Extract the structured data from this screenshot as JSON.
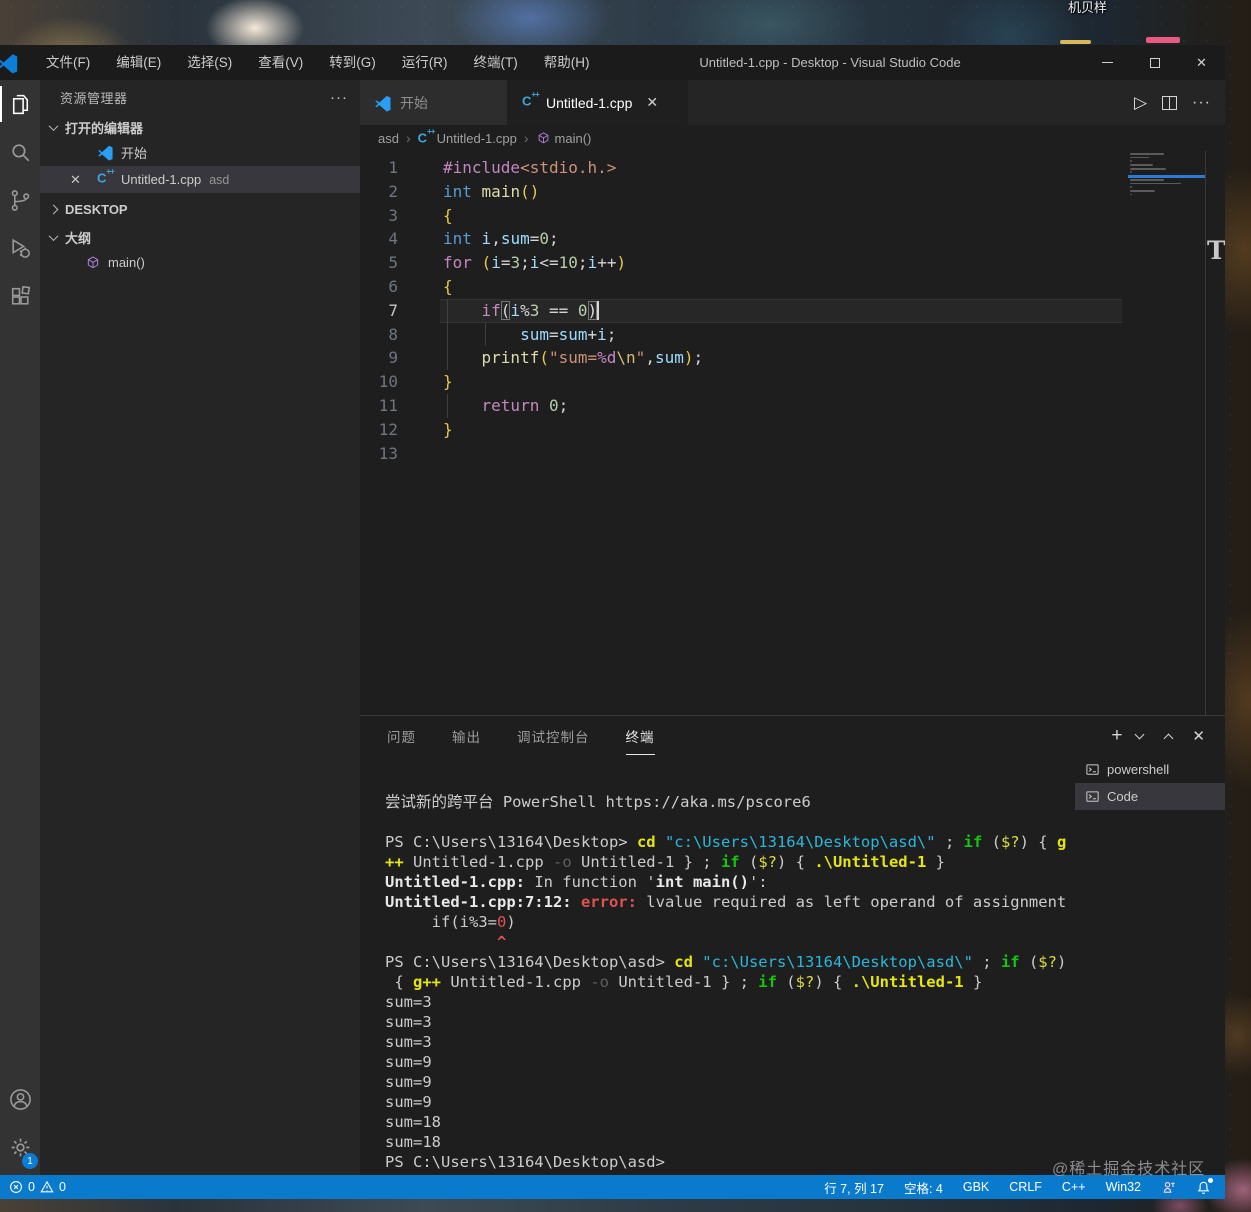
{
  "desktop": {
    "top_label": "机贝样",
    "watermark": "@稀土掘金技术社区",
    "stray_letter": "T"
  },
  "title_bar": {
    "title": "Untitled-1.cpp - Desktop - Visual Studio Code",
    "menus": [
      "文件(F)",
      "编辑(E)",
      "选择(S)",
      "查看(V)",
      "转到(G)",
      "运行(R)",
      "终端(T)",
      "帮助(H)"
    ]
  },
  "sidebar": {
    "title": "资源管理器",
    "open_editors_label": "打开的编辑器",
    "folder_label": "DESKTOP",
    "outline_label": "大纲",
    "open_editors": [
      {
        "label": "开始",
        "selected": false
      },
      {
        "label": "Untitled-1.cpp",
        "description": "asd",
        "selected": true
      }
    ],
    "outline_items": [
      {
        "label": "main()"
      }
    ]
  },
  "icons": {
    "cpp_glyph": "C",
    "cpp_plus": "++"
  },
  "tabs": [
    {
      "label": "开始",
      "active": false
    },
    {
      "label": "Untitled-1.cpp",
      "active": true
    }
  ],
  "breadcrumb": {
    "parts": [
      "asd",
      "Untitled-1.cpp",
      "main()"
    ]
  },
  "editor": {
    "current_line": 7,
    "cursor": "行 7, 列 17",
    "lines": [
      [
        {
          "t": "#include",
          "c": "kw"
        },
        {
          "t": "<stdio.h.>",
          "c": "str"
        }
      ],
      [
        {
          "t": "int",
          "c": "type"
        },
        {
          "t": " ",
          "c": "pl"
        },
        {
          "t": "main",
          "c": "fn"
        },
        {
          "t": "()",
          "c": "b1"
        }
      ],
      [
        {
          "t": "{",
          "c": "b1"
        }
      ],
      [
        {
          "t": "int",
          "c": "type"
        },
        {
          "t": " ",
          "c": "pl"
        },
        {
          "t": "i",
          "c": "var"
        },
        {
          "t": ",",
          "c": "pl"
        },
        {
          "t": "sum",
          "c": "var"
        },
        {
          "t": "=",
          "c": "pl"
        },
        {
          "t": "0",
          "c": "num"
        },
        {
          "t": ";",
          "c": "pl"
        }
      ],
      [
        {
          "t": "for",
          "c": "kw"
        },
        {
          "t": " ",
          "c": "pl"
        },
        {
          "t": "(",
          "c": "b1"
        },
        {
          "t": "i",
          "c": "var"
        },
        {
          "t": "=",
          "c": "pl"
        },
        {
          "t": "3",
          "c": "num"
        },
        {
          "t": ";",
          "c": "pl"
        },
        {
          "t": "i",
          "c": "var"
        },
        {
          "t": "<=",
          "c": "pl"
        },
        {
          "t": "10",
          "c": "num"
        },
        {
          "t": ";",
          "c": "pl"
        },
        {
          "t": "i",
          "c": "var"
        },
        {
          "t": "++",
          "c": "pl"
        },
        {
          "t": ")",
          "c": "b1"
        }
      ],
      [
        {
          "t": "{",
          "c": "b1"
        }
      ],
      [
        {
          "t": "    ",
          "c": "pl"
        },
        {
          "t": "if",
          "c": "kw"
        },
        {
          "t": "(",
          "c": "bm"
        },
        {
          "t": "i",
          "c": "var"
        },
        {
          "t": "%",
          "c": "pl"
        },
        {
          "t": "3",
          "c": "num"
        },
        {
          "t": " == ",
          "c": "pl"
        },
        {
          "t": "0",
          "c": "num"
        },
        {
          "t": ")",
          "c": "bm"
        }
      ],
      [
        {
          "t": "        ",
          "c": "pl"
        },
        {
          "t": "sum",
          "c": "var"
        },
        {
          "t": "=",
          "c": "pl"
        },
        {
          "t": "sum",
          "c": "var"
        },
        {
          "t": "+",
          "c": "pl"
        },
        {
          "t": "i",
          "c": "var"
        },
        {
          "t": ";",
          "c": "pl"
        }
      ],
      [
        {
          "t": "    ",
          "c": "pl"
        },
        {
          "t": "printf",
          "c": "fn"
        },
        {
          "t": "(",
          "c": "b1"
        },
        {
          "t": "\"",
          "c": "str"
        },
        {
          "t": "sum=",
          "c": "str"
        },
        {
          "t": "%d",
          "c": "fmt"
        },
        {
          "t": "\\n",
          "c": "esc"
        },
        {
          "t": "\"",
          "c": "str"
        },
        {
          "t": ",",
          "c": "pl"
        },
        {
          "t": "sum",
          "c": "var"
        },
        {
          "t": ")",
          "c": "b1"
        },
        {
          "t": ";",
          "c": "pl"
        }
      ],
      [
        {
          "t": "}",
          "c": "b1"
        }
      ],
      [
        {
          "t": "    ",
          "c": "pl"
        },
        {
          "t": "return",
          "c": "kw"
        },
        {
          "t": " ",
          "c": "pl"
        },
        {
          "t": "0",
          "c": "num"
        },
        {
          "t": ";",
          "c": "pl"
        }
      ],
      [
        {
          "t": "}",
          "c": "b1"
        }
      ],
      []
    ]
  },
  "panel": {
    "tabs": [
      "问题",
      "输出",
      "调试控制台",
      "终端"
    ],
    "active_tab": "终端",
    "terminal_list": [
      {
        "label": "powershell",
        "selected": false
      },
      {
        "label": "Code",
        "selected": true
      }
    ],
    "terminal_lines": [
      [
        {
          "t": "尝试新的跨平台 PowerShell https://aka.ms/pscore6",
          "c": "w"
        }
      ],
      [],
      [
        {
          "t": "PS C:\\Users\\13164\\Desktop> ",
          "c": "w"
        },
        {
          "t": "cd ",
          "c": "yb"
        },
        {
          "t": "\"c:\\Users\\13164\\Desktop\\asd\\\" ",
          "c": "c"
        },
        {
          "t": "; ",
          "c": "w"
        },
        {
          "t": "if",
          "c": "g"
        },
        {
          "t": " (",
          "c": "w"
        },
        {
          "t": "$?",
          "c": "y"
        },
        {
          "t": ") { ",
          "c": "w"
        },
        {
          "t": "g",
          "c": "yb"
        }
      ],
      [
        {
          "t": "++",
          "c": "yb"
        },
        {
          "t": " Untitled-1.cpp ",
          "c": "w"
        },
        {
          "t": "-o",
          "c": "dim"
        },
        {
          "t": " Untitled-1 } ; ",
          "c": "w"
        },
        {
          "t": "if",
          "c": "g"
        },
        {
          "t": " (",
          "c": "w"
        },
        {
          "t": "$?",
          "c": "y"
        },
        {
          "t": ") { ",
          "c": "w"
        },
        {
          "t": ".\\Untitled-1",
          "c": "yb"
        },
        {
          "t": " }",
          "c": "w"
        }
      ],
      [
        {
          "t": "Untitled-1.cpp: ",
          "c": "wb"
        },
        {
          "t": "In function '",
          "c": "w"
        },
        {
          "t": "int main()",
          "c": "wb"
        },
        {
          "t": "':",
          "c": "w"
        }
      ],
      [
        {
          "t": "Untitled-1.cpp:7:12: ",
          "c": "wb"
        },
        {
          "t": "error: ",
          "c": "rb"
        },
        {
          "t": "lvalue required as left operand of assignment",
          "c": "w"
        }
      ],
      [
        {
          "t": "     if(i%3=",
          "c": "w"
        },
        {
          "t": "0",
          "c": "r"
        },
        {
          "t": ")",
          "c": "w"
        }
      ],
      [
        {
          "t": "            ^",
          "c": "rb"
        }
      ],
      [
        {
          "t": "PS C:\\Users\\13164\\Desktop\\asd> ",
          "c": "w"
        },
        {
          "t": "cd ",
          "c": "yb"
        },
        {
          "t": "\"c:\\Users\\13164\\Desktop\\asd\\\" ",
          "c": "c"
        },
        {
          "t": "; ",
          "c": "w"
        },
        {
          "t": "if",
          "c": "g"
        },
        {
          "t": " (",
          "c": "w"
        },
        {
          "t": "$?",
          "c": "y"
        },
        {
          "t": ")",
          "c": "w"
        }
      ],
      [
        {
          "t": " { ",
          "c": "w"
        },
        {
          "t": "g++",
          "c": "yb"
        },
        {
          "t": " Untitled-1.cpp ",
          "c": "w"
        },
        {
          "t": "-o",
          "c": "dim"
        },
        {
          "t": " Untitled-1 } ; ",
          "c": "w"
        },
        {
          "t": "if",
          "c": "g"
        },
        {
          "t": " (",
          "c": "w"
        },
        {
          "t": "$?",
          "c": "y"
        },
        {
          "t": ") { ",
          "c": "w"
        },
        {
          "t": ".\\Untitled-1",
          "c": "yb"
        },
        {
          "t": " }",
          "c": "w"
        }
      ],
      [
        {
          "t": "sum=3",
          "c": "w"
        }
      ],
      [
        {
          "t": "sum=3",
          "c": "w"
        }
      ],
      [
        {
          "t": "sum=3",
          "c": "w"
        }
      ],
      [
        {
          "t": "sum=9",
          "c": "w"
        }
      ],
      [
        {
          "t": "sum=9",
          "c": "w"
        }
      ],
      [
        {
          "t": "sum=9",
          "c": "w"
        }
      ],
      [
        {
          "t": "sum=18",
          "c": "w"
        }
      ],
      [
        {
          "t": "sum=18",
          "c": "w"
        }
      ],
      [
        {
          "t": "PS C:\\Users\\13164\\Desktop\\asd>",
          "c": "w"
        }
      ]
    ]
  },
  "status_bar": {
    "errors": "0",
    "warnings": "0",
    "items": [
      "行 7, 列 17",
      "空格: 4",
      "GBK",
      "CRLF",
      "C++",
      "Win32"
    ]
  }
}
